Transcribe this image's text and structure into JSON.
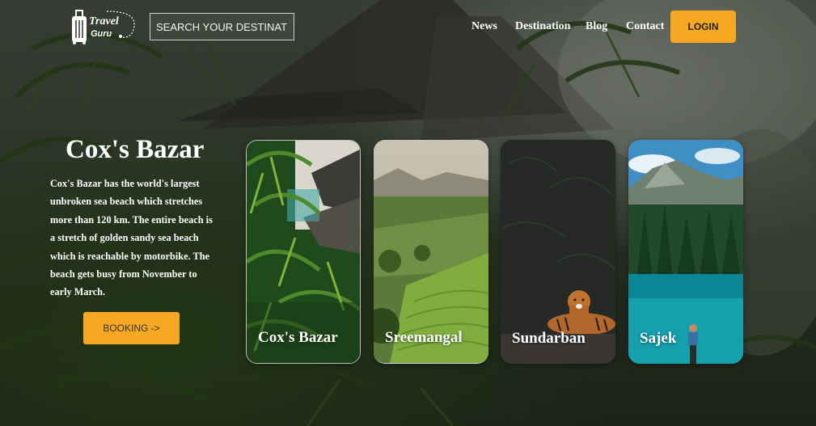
{
  "brand": {
    "line1": "Travel",
    "line2": "Guru"
  },
  "search": {
    "placeholder": "SEARCH YOUR DESTINATION"
  },
  "nav": {
    "items": [
      {
        "label": "News"
      },
      {
        "label": "Destination"
      },
      {
        "label": "Blog"
      },
      {
        "label": "Contact"
      }
    ]
  },
  "login": {
    "label": "LOGIN"
  },
  "hero": {
    "title": "Cox's Bazar",
    "description": "Cox's Bazar has the world's largest unbroken sea beach which stretches more than 120 km. The entire beach is a stretch of golden sandy sea beach which is reachable by motorbike. The beach gets busy from November to early March.",
    "button": "BOOKING ->"
  },
  "cards": [
    {
      "label": "Cox's Bazar"
    },
    {
      "label": "Sreemangal"
    },
    {
      "label": "Sundarban"
    },
    {
      "label": "Sajek"
    }
  ],
  "colors": {
    "accent": "#f7a823"
  }
}
